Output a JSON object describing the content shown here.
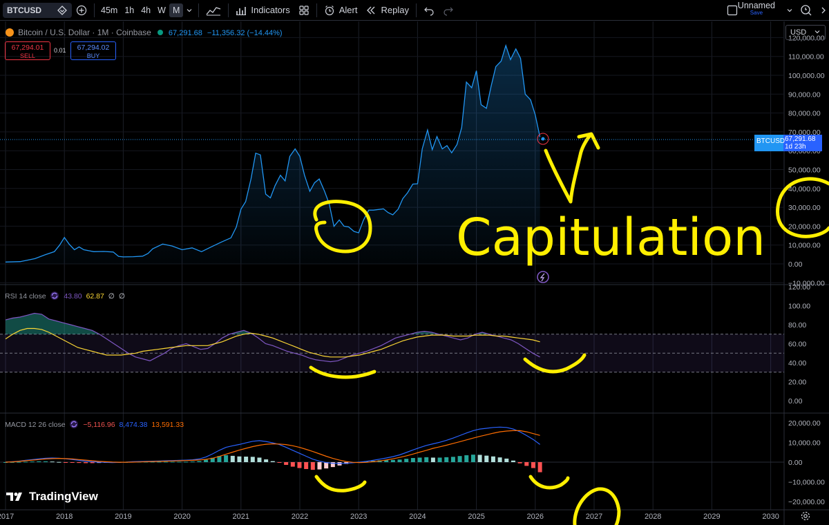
{
  "toolbar": {
    "symbol": "BTCUSD",
    "timeframes": [
      "45m",
      "1h",
      "4h",
      "W",
      "M"
    ],
    "active_timeframe": "M",
    "indicators_label": "Indicators",
    "alert_label": "Alert",
    "replay_label": "Replay",
    "layout_name": "Unnamed",
    "save_label": "Save"
  },
  "legend": {
    "title": "Bitcoin / U.S. Dollar · 1M · Coinbase",
    "last": "67,291.68",
    "change": "−11,356.32 (−14.44%)",
    "sell_price": "67,294.01",
    "sell_label": "SELL",
    "spread": "0.01",
    "buy_price": "67,294.02",
    "buy_label": "BUY"
  },
  "currency": "USD",
  "price_tag": {
    "symbol": "BTCUSD",
    "price": "67,291.68",
    "countdown": "1d 23h"
  },
  "rsi_legend": {
    "name": "RSI 14 close",
    "rsi": "43.80",
    "ma": "62.87",
    "extra1": "∅",
    "extra2": "∅"
  },
  "macd_legend": {
    "name": "MACD 12 26 close",
    "hist": "−5,116.96",
    "macd": "8,474.38",
    "signal": "13,591.33"
  },
  "annotation": "Capitulation",
  "watermark": "TradingView",
  "colors": {
    "price": "#2196f3",
    "rsi": "#7e57c2",
    "rsi_ma": "#fdd835",
    "macd": "#2962ff",
    "signal": "#ff6d00",
    "hist_up": "#26a69a",
    "hist_down": "#ef5350",
    "annot": "#ffef00"
  },
  "chart_data": [
    {
      "type": "area",
      "x_ticks": [
        "2017",
        "2018",
        "2019",
        "2020",
        "2021",
        "2022",
        "2023",
        "2024",
        "2025",
        "2026",
        "2027",
        "2028",
        "2029",
        "2030"
      ],
      "y_ticks": [
        "−10,000.00",
        "0.00",
        "10,000.00",
        "20,000.00",
        "30,000.00",
        "40,000.00",
        "50,000.00",
        "60,000.00",
        "70,000.00",
        "80,000.00",
        "90,000.00",
        "100,000.00",
        "110,000.00",
        "120,000.00"
      ],
      "ylim": [
        -10000,
        120000
      ],
      "x": [
        2017.0,
        2017.25,
        2017.5,
        2017.67,
        2017.83,
        2017.92,
        2018.0,
        2018.08,
        2018.17,
        2018.25,
        2018.33,
        2018.5,
        2018.67,
        2018.83,
        2018.92,
        2019.0,
        2019.17,
        2019.33,
        2019.42,
        2019.5,
        2019.67,
        2019.83,
        2020.0,
        2020.17,
        2020.33,
        2020.5,
        2020.67,
        2020.83,
        2020.92,
        2021.0,
        2021.08,
        2021.17,
        2021.25,
        2021.33,
        2021.42,
        2021.5,
        2021.58,
        2021.67,
        2021.75,
        2021.83,
        2021.92,
        2022.0,
        2022.08,
        2022.17,
        2022.25,
        2022.33,
        2022.42,
        2022.5,
        2022.58,
        2022.67,
        2022.75,
        2022.83,
        2022.92,
        2023.0,
        2023.08,
        2023.17,
        2023.25,
        2023.42,
        2023.5,
        2023.58,
        2023.67,
        2023.75,
        2023.83,
        2023.92,
        2024.0,
        2024.08,
        2024.17,
        2024.25,
        2024.33,
        2024.42,
        2024.5,
        2024.58,
        2024.67,
        2024.75,
        2024.83,
        2024.92,
        2025.0,
        2025.08,
        2025.17,
        2025.25,
        2025.33,
        2025.42,
        2025.5,
        2025.58,
        2025.67,
        2025.75,
        2025.83,
        2025.92,
        2026.0,
        2026.08
      ],
      "series": [
        {
          "values": [
            1000,
            1200,
            2800,
            4800,
            6500,
            10000,
            14000,
            10500,
            7500,
            9000,
            7500,
            6500,
            6600,
            6300,
            4000,
            3700,
            3800,
            4100,
            5500,
            8000,
            10500,
            9500,
            7500,
            8500,
            6500,
            9100,
            11600,
            13800,
            19500,
            29000,
            33000,
            45000,
            58700,
            57800,
            37000,
            35000,
            41500,
            47000,
            44000,
            57000,
            61000,
            57000,
            47000,
            38500,
            43000,
            45000,
            38500,
            31800,
            19900,
            23300,
            20000,
            19600,
            17200,
            16500,
            23100,
            28500,
            28500,
            29200,
            27200,
            26000,
            29000,
            34600,
            37700,
            42300,
            42500,
            61000,
            71000,
            60600,
            67500,
            61000,
            62700,
            58900,
            63300,
            72300,
            96400,
            93400,
            102400,
            84400,
            82500,
            94200,
            104600,
            107500,
            115800,
            108300,
            114000,
            109000,
            90000,
            87000,
            79000,
            67300
          ]
        }
      ]
    },
    {
      "type": "line",
      "name": "RSI",
      "y_ticks": [
        "0.00",
        "20.00",
        "40.00",
        "60.00",
        "80.00",
        "100.00",
        "120.00"
      ],
      "ylim": [
        -5,
        124
      ],
      "bands": [
        30,
        50,
        70
      ],
      "x_start": 2017.0,
      "x_end": 2026.08,
      "rsi": [
        85,
        87,
        88,
        90,
        92,
        91,
        86,
        84,
        82,
        80,
        78,
        76,
        74,
        70,
        65,
        60,
        55,
        50,
        46,
        44,
        42,
        46,
        50,
        55,
        58,
        60,
        57,
        54,
        55,
        60,
        66,
        70,
        72,
        74,
        71,
        66,
        60,
        58,
        55,
        52,
        50,
        48,
        45,
        43,
        42,
        41,
        42,
        45,
        48,
        50,
        52,
        55,
        58,
        62,
        66,
        68,
        70,
        72,
        73,
        72,
        70,
        68,
        66,
        64,
        66,
        70,
        72,
        70,
        68,
        66,
        64,
        60,
        55,
        50,
        46
      ],
      "rsi_ma": [
        65,
        70,
        74,
        76,
        76,
        75,
        72,
        68,
        64,
        60,
        56,
        54,
        52,
        50,
        48,
        48,
        48,
        49,
        50,
        52,
        53,
        54,
        55,
        56,
        57,
        58,
        58,
        58,
        58,
        60,
        62,
        65,
        68,
        70,
        71,
        70,
        68,
        66,
        63,
        60,
        57,
        54,
        51,
        49,
        47,
        46,
        46,
        46,
        47,
        48,
        50,
        52,
        54,
        57,
        60,
        63,
        65,
        67,
        68,
        69,
        69,
        69,
        68,
        68,
        68,
        69,
        69,
        69,
        68,
        68,
        67,
        66,
        65,
        64,
        62
      ]
    },
    {
      "type": "bar",
      "name": "MACD",
      "y_ticks": [
        "−20,000.00",
        "−10,000.00",
        "0.00",
        "10,000.00",
        "20,000.00"
      ],
      "ylim": [
        -25000,
        22000
      ],
      "macd": [
        0,
        200,
        500,
        900,
        1300,
        1700,
        2000,
        2100,
        2000,
        1700,
        1300,
        900,
        500,
        200,
        0,
        -100,
        -200,
        -100,
        0,
        200,
        300,
        400,
        500,
        600,
        700,
        800,
        900,
        1000,
        1200,
        1600,
        2600,
        4200,
        6000,
        7500,
        8300,
        9000,
        9800,
        10600,
        10900,
        10500,
        9800,
        8900,
        7500,
        6000,
        4500,
        3000,
        1500,
        500,
        -200,
        -600,
        -700,
        -600,
        -300,
        0,
        400,
        900,
        1500,
        2100,
        2800,
        3700,
        4900,
        6200,
        7400,
        8500,
        9300,
        10100,
        11100,
        12200,
        13500,
        14800,
        16000,
        16800,
        17200,
        17600,
        17800,
        17600,
        16800,
        15400,
        13500,
        11500,
        9000
      ],
      "signal": [
        0,
        150,
        400,
        700,
        1000,
        1300,
        1600,
        1800,
        1900,
        1800,
        1600,
        1300,
        1000,
        700,
        400,
        200,
        50,
        -50,
        -50,
        0,
        100,
        200,
        300,
        400,
        500,
        600,
        700,
        800,
        900,
        1100,
        1400,
        2000,
        2900,
        4000,
        5100,
        6100,
        7000,
        7900,
        8600,
        9100,
        9300,
        9200,
        8900,
        8300,
        7500,
        6500,
        5400,
        4200,
        3000,
        1900,
        1000,
        300,
        -100,
        -200,
        -100,
        200,
        600,
        1100,
        1700,
        2400,
        3200,
        4100,
        5100,
        6000,
        7000,
        7800,
        8600,
        9500,
        10400,
        11300,
        12200,
        13100,
        13900,
        14700,
        15400,
        15800,
        16000,
        16000,
        15400,
        14500,
        13591
      ],
      "hist": [
        0,
        50,
        100,
        200,
        300,
        400,
        400,
        300,
        100,
        -100,
        -300,
        -400,
        -500,
        -500,
        -400,
        -300,
        -250,
        -50,
        50,
        200,
        200,
        200,
        200,
        200,
        200,
        200,
        200,
        200,
        300,
        500,
        1200,
        2200,
        3100,
        3500,
        3200,
        2900,
        2800,
        2700,
        2300,
        1400,
        500,
        -300,
        -1400,
        -2300,
        -3000,
        -3500,
        -3900,
        -3700,
        -3200,
        -2500,
        -1700,
        -900,
        -200,
        200,
        500,
        700,
        900,
        1000,
        1100,
        1300,
        1700,
        2100,
        2300,
        2500,
        2300,
        2300,
        2500,
        2700,
        3100,
        3500,
        3800,
        3700,
        3300,
        2900,
        2400,
        1800,
        800,
        -600,
        -1900,
        -3000,
        -5117
      ]
    }
  ]
}
